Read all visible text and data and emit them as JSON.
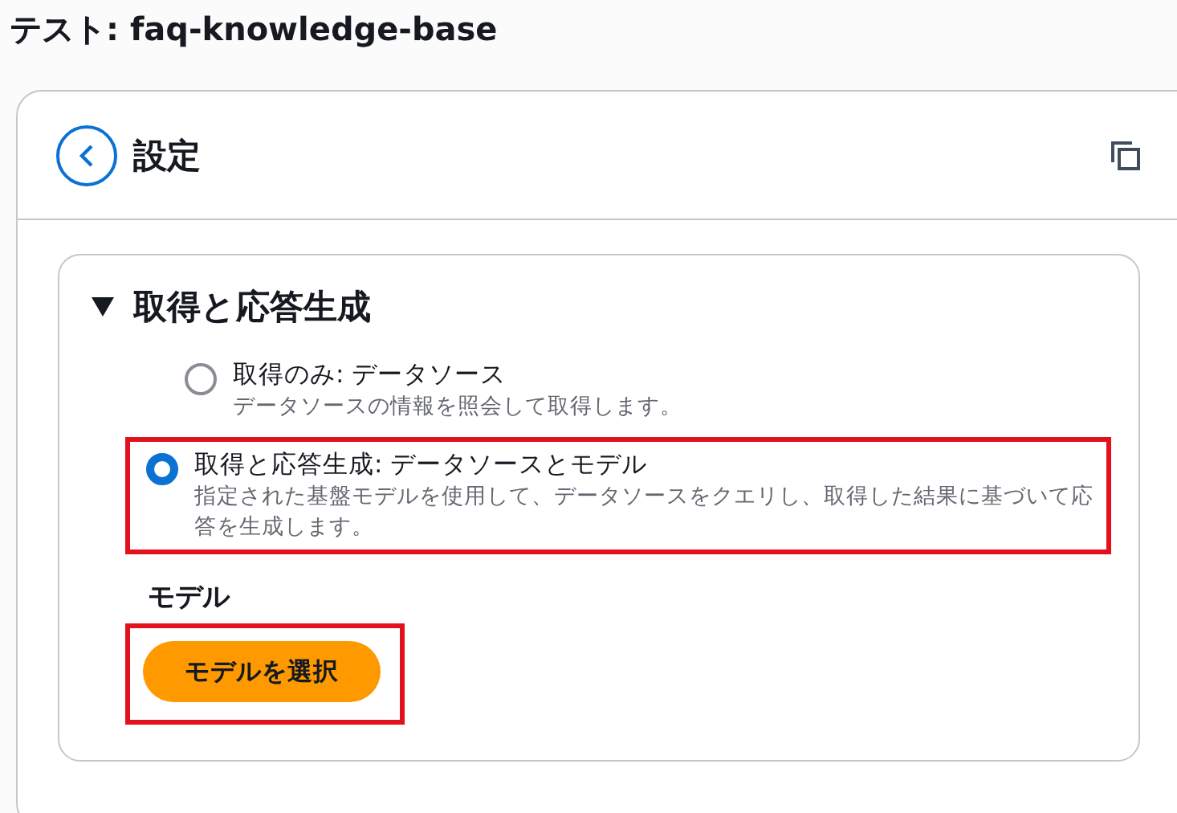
{
  "page_title": "テスト: faq-knowledge-base",
  "panel": {
    "title": "設定",
    "section": {
      "title": "取得と応答生成",
      "expanded": true,
      "options": [
        {
          "label": "取得のみ: データソース",
          "description": "データソースの情報を照会して取得します。",
          "selected": false,
          "highlighted": false
        },
        {
          "label": "取得と応答生成: データソースとモデル",
          "description": "指定された基盤モデルを使用して、データソースをクエリし、取得した結果に基づいて応答を生成します。",
          "selected": true,
          "highlighted": true
        }
      ],
      "model_label": "モデル",
      "model_button": {
        "label": "モデルを選択",
        "highlighted": true
      }
    }
  }
}
